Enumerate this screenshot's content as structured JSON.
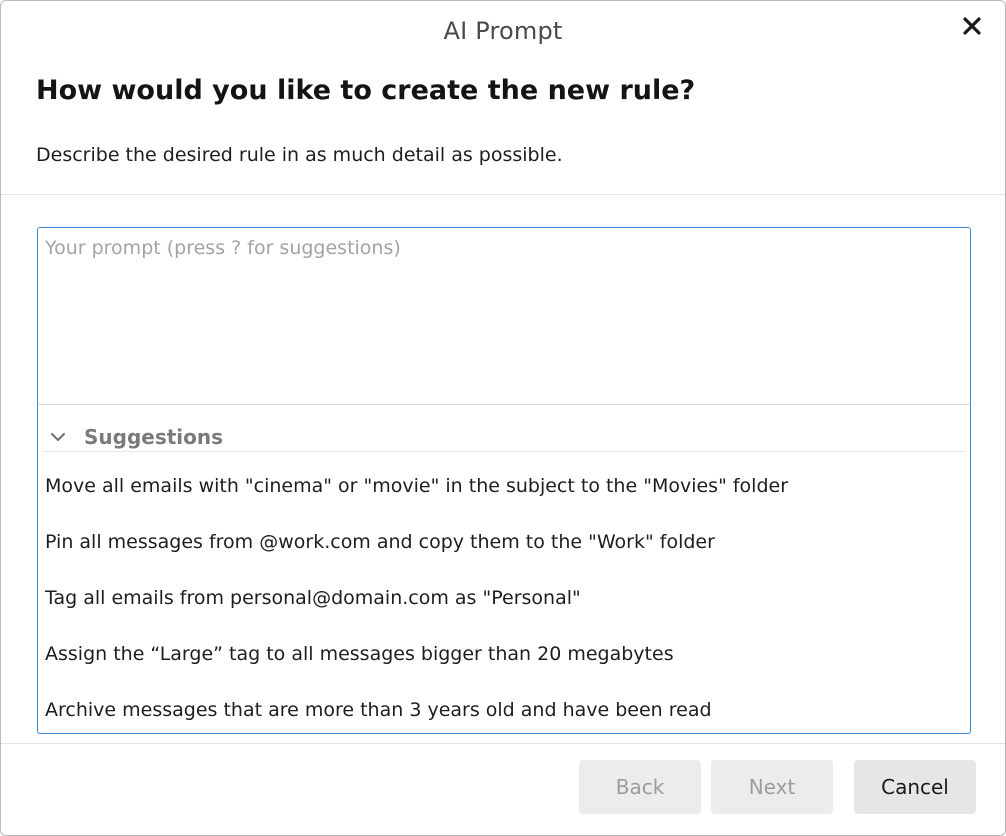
{
  "window": {
    "title": "AI Prompt",
    "close_icon": "close-icon"
  },
  "header": {
    "heading": "How would you like to create the new rule?",
    "description": "Describe the desired rule in as much detail as possible."
  },
  "prompt": {
    "value": "",
    "placeholder": "Your prompt (press ? for suggestions)"
  },
  "suggestions": {
    "title": "Suggestions",
    "expanded": true,
    "toggle_icon": "chevron-down-icon",
    "items": [
      "Move all emails with \"cinema\" or \"movie\" in the subject to the \"Movies\" folder",
      "Pin all messages from @work.com and copy them to the \"Work\" folder",
      "Tag all emails from personal@domain.com as \"Personal\"",
      "Assign the “Large” tag to all messages bigger than 20 megabytes",
      "Archive messages that are more than 3 years old and have been read"
    ]
  },
  "footer": {
    "back_label": "Back",
    "next_label": "Next",
    "cancel_label": "Cancel"
  },
  "colors": {
    "focus_border": "#3b86d8",
    "disabled_text": "#9c9c9c",
    "button_bg": "#ececec"
  }
}
